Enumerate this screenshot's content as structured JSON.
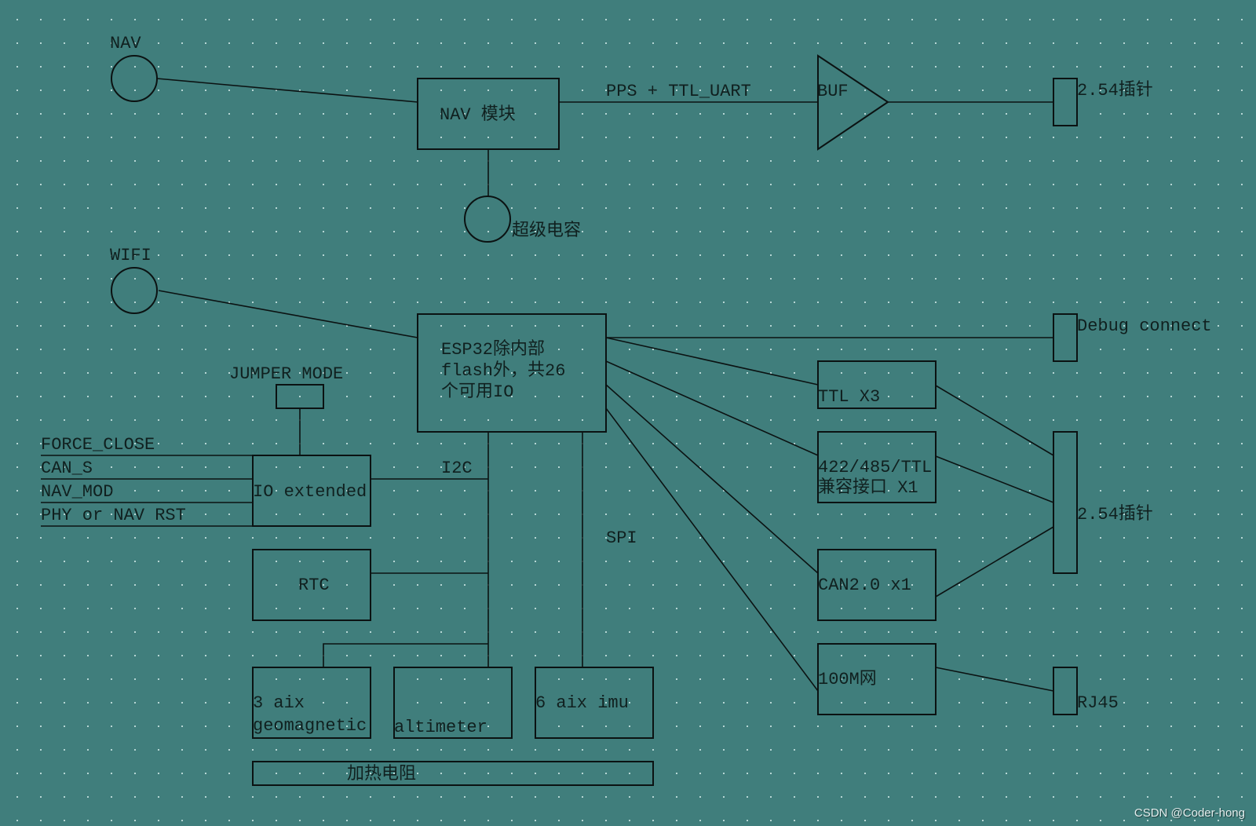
{
  "diagram": {
    "antennas": {
      "nav": "NAV",
      "wifi": "WIFI"
    },
    "nav_module": "NAV 模块",
    "super_capacitor": "超级电容",
    "nav_link": "PPS + TTL_UART",
    "buffer": "BUF",
    "pin_header_top": "2.54插针",
    "esp32": {
      "line1": "ESP32除内部",
      "line2": "flash外，共26",
      "line3": "个可用IO"
    },
    "debug_connect": "Debug connect",
    "jumper_mode": "JUMPER MODE",
    "io_signals": [
      "FORCE_CLOSE",
      "CAN_S",
      "NAV_MOD",
      "PHY or NAV RST"
    ],
    "io_extended": "IO extended",
    "i2c": "I2C",
    "spi": "SPI",
    "rtc": "RTC",
    "geomagnetic": {
      "line1": "3 aix",
      "line2": "geomagnetic"
    },
    "altimeter": "altimeter",
    "imu": "6 aix imu",
    "heater": "加热电阻",
    "ttl": "TTL X3",
    "rs_interface": {
      "line1": "422/485/TTL",
      "line2": "兼容接口 X1"
    },
    "can": "CAN2.0 x1",
    "ethernet": "100M网",
    "pin_header_right": "2.54插针",
    "rj45": "RJ45"
  },
  "watermark": "CSDN @Coder-hong"
}
